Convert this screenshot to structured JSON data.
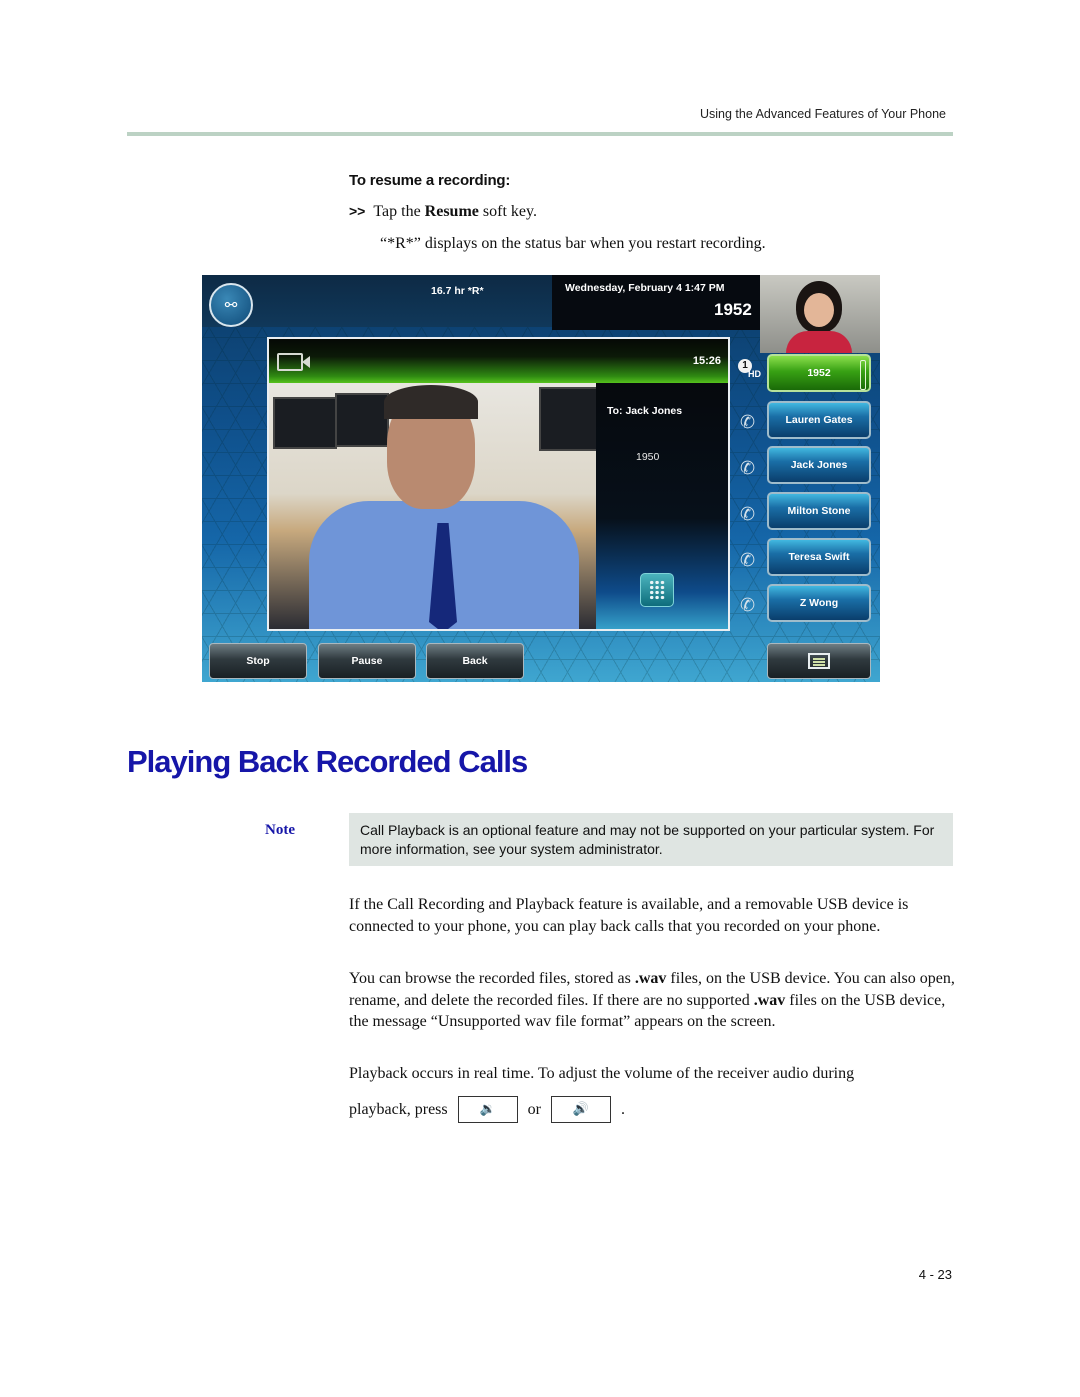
{
  "header": {
    "running_title": "Using the Advanced Features of Your Phone"
  },
  "procedure": {
    "title": "To resume a recording:",
    "step_bullet": ">>",
    "step_prefix": "Tap the ",
    "step_key": "Resume",
    "step_suffix": " soft key.",
    "result": "“*R*” displays on the status bar when you restart recording."
  },
  "phone_screen": {
    "status_bar": {
      "usb_icon": "usb-recording-icon",
      "recording_status": "16.7 hr  *R*",
      "datetime": "Wednesday, February 4  1:47 PM",
      "extension": "1952"
    },
    "call": {
      "video_icon": "video-camera-icon",
      "timer": "15:26",
      "to_label": "To: Jack Jones",
      "to_number": "1950",
      "dialpad_icon": "dialpad-icon"
    },
    "line_indicator": {
      "line_number": "1",
      "hd_label": "HD"
    },
    "line_keys": [
      {
        "label": "1952",
        "active": true
      },
      {
        "label": "Lauren Gates",
        "active": false
      },
      {
        "label": "Jack Jones",
        "active": false
      },
      {
        "label": "Milton Stone",
        "active": false
      },
      {
        "label": "Teresa Swift",
        "active": false
      },
      {
        "label": "Z Wong",
        "active": false
      }
    ],
    "soft_keys": [
      "Stop",
      "Pause",
      "Back"
    ],
    "menu_icon": "menu-icon",
    "colors": {
      "active_call_green": "#38a114",
      "line_key_blue": "#1a6ea6",
      "background_blue": "#0f4f8a"
    }
  },
  "section": {
    "title": "Playing Back Recorded Calls",
    "title_color": "#1616a8"
  },
  "note": {
    "label": "Note",
    "text": "Call Playback is an optional feature and may not be supported on your particular system. For more information, see your system administrator."
  },
  "body": {
    "p1": "If the Call Recording and Playback feature is available, and a removable USB device is connected to your phone, you can play back calls that you recorded on your phone.",
    "p2_a": "You can browse the recorded files, stored as ",
    "p2_b": ".wav",
    "p2_c": " files, on the USB device. You can also open, rename, and delete the recorded files. If there are no supported ",
    "p2_d": ".wav",
    "p2_e": " files on the USB device, the message “Unsupported wav file format” appears on the screen.",
    "p3": "Playback occurs in real time. To adjust the volume of the receiver audio during",
    "p4_prefix": "playback, press",
    "p4_or": "or",
    "p4_suffix": ".",
    "volume_down_glyph": "🔉",
    "volume_up_glyph": "🔊"
  },
  "footer": {
    "page_number": "4 - 23"
  }
}
